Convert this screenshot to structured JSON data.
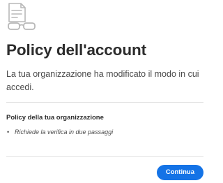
{
  "dialog": {
    "illustration_icon": "document-with-glasses-icon",
    "title": "Policy dell'account",
    "description": "La tua organizzazione ha modificato il modo in cui accedi.",
    "section_title": "Policy della tua organizzazione",
    "policies": [
      "Richiede la verifica in due passaggi"
    ],
    "continue_label": "Continua",
    "colors": {
      "accent": "#1473e6",
      "title": "#2c2c2c",
      "text": "#4b4b4b",
      "divider": "#e1e1e1",
      "illustration": "#b8b8b8"
    }
  }
}
